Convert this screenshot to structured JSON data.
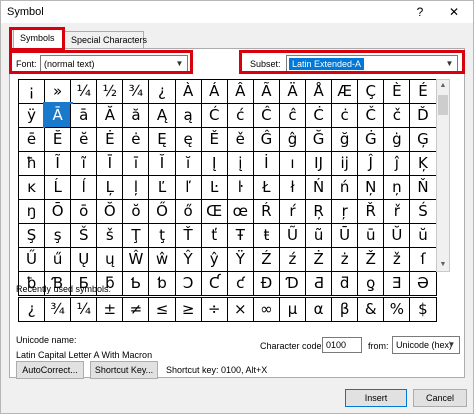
{
  "window": {
    "title": "Symbol",
    "help_label": "?",
    "close_label": "✕"
  },
  "tabs": [
    {
      "label": "Symbols",
      "active": true
    },
    {
      "label": "Special Characters",
      "active": false
    }
  ],
  "font": {
    "label": "Font:",
    "value": "(normal text)"
  },
  "subset": {
    "label": "Subset:",
    "value": "Latin Extended-A"
  },
  "symbols": [
    [
      "¡",
      "»",
      "¼",
      "½",
      "¾",
      "¿",
      "À",
      "Á",
      "Â",
      "Ã",
      "Ä",
      "Å",
      "Æ",
      "Ç",
      "È",
      "É"
    ],
    [
      "ÿ",
      "Ā",
      "ā",
      "Ă",
      "ă",
      "Ą",
      "ą",
      "Ć",
      "ć",
      "Ĉ",
      "ĉ",
      "Ċ",
      "ċ",
      "Č",
      "č",
      "Ď"
    ],
    [
      "ē",
      "Ĕ",
      "ĕ",
      "Ė",
      "ė",
      "Ę",
      "ę",
      "Ě",
      "ě",
      "Ĝ",
      "ĝ",
      "Ğ",
      "ğ",
      "Ġ",
      "ġ",
      "Ģ"
    ],
    [
      "ħ",
      "Ĩ",
      "ĩ",
      "Ī",
      "ī",
      "Ĭ",
      "ĭ",
      "Į",
      "į",
      "İ",
      "ı",
      "Ĳ",
      "ĳ",
      "Ĵ",
      "ĵ",
      "Ķ"
    ],
    [
      "ĸ",
      "Ĺ",
      "ĺ",
      "Ļ",
      "ļ",
      "Ľ",
      "ľ",
      "Ŀ",
      "ŀ",
      "Ł",
      "ł",
      "Ń",
      "ń",
      "Ņ",
      "ņ",
      "Ň"
    ],
    [
      "ŋ",
      "Ō",
      "ō",
      "Ŏ",
      "ŏ",
      "Ő",
      "ő",
      "Œ",
      "œ",
      "Ŕ",
      "ŕ",
      "Ŗ",
      "ŗ",
      "Ř",
      "ř",
      "Ś"
    ],
    [
      "Ş",
      "ş",
      "Š",
      "š",
      "Ţ",
      "ţ",
      "Ť",
      "ť",
      "Ŧ",
      "ŧ",
      "Ũ",
      "ũ",
      "Ū",
      "ū",
      "Ŭ",
      "ŭ"
    ],
    [
      "Ű",
      "ű",
      "Ų",
      "ų",
      "Ŵ",
      "ŵ",
      "Ŷ",
      "ŷ",
      "Ÿ",
      "Ź",
      "ź",
      "Ż",
      "ż",
      "Ž",
      "ž",
      "ſ"
    ],
    [
      "ƀ",
      "Ɓ",
      "Ƃ",
      "ƃ",
      "Ƅ",
      "ƅ",
      "Ɔ",
      "Ƈ",
      "ƈ",
      "Ɖ",
      "Ɗ",
      "Ƌ",
      "ƌ",
      "ƍ",
      "Ǝ",
      "Ə"
    ]
  ],
  "selected_symbol": {
    "row": 1,
    "col": 1
  },
  "recent": {
    "label": "Recently used symbols:",
    "items": [
      "¿",
      "¾",
      "¼",
      "±",
      "≠",
      "≤",
      "≥",
      "÷",
      "×",
      "∞",
      "µ",
      "α",
      "β",
      "&",
      "%",
      "$"
    ]
  },
  "unicode_name": {
    "label": "Unicode name:",
    "value": "Latin Capital Letter A With Macron"
  },
  "character_code": {
    "label": "Character code:",
    "value": "0100"
  },
  "from": {
    "label": "from:",
    "value": "Unicode (hex)"
  },
  "buttons": {
    "autocorrect": "AutoCorrect...",
    "shortcut_key": "Shortcut Key...",
    "insert": "Insert",
    "cancel": "Cancel"
  },
  "shortcut_text": "Shortcut key: 0100, Alt+X",
  "colors": {
    "highlight": "#d9000d",
    "selection": "#1979ca"
  }
}
